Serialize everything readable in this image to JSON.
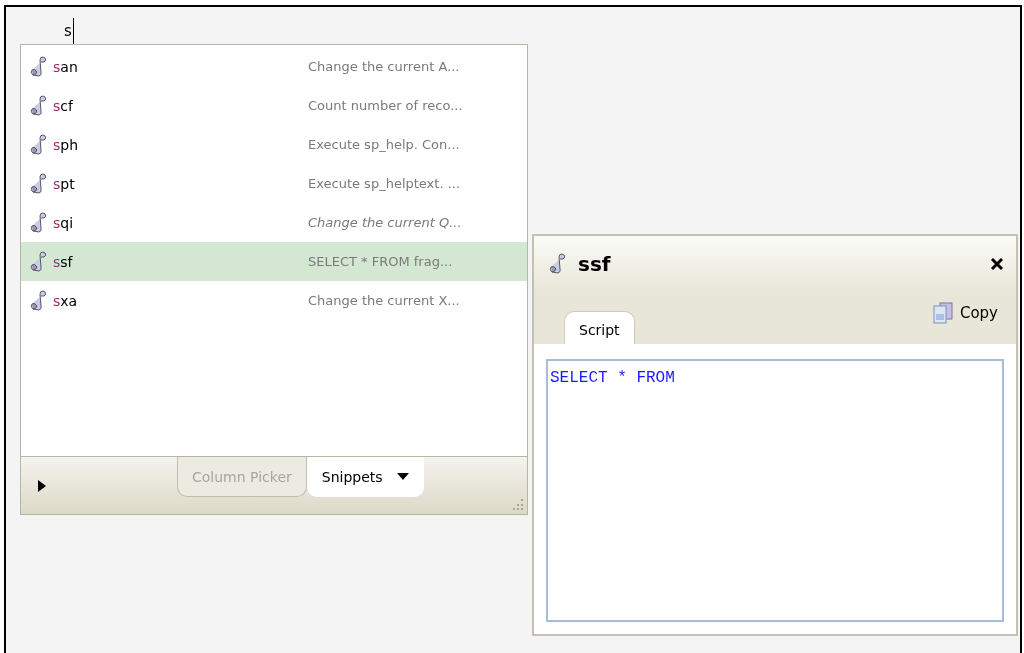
{
  "input": {
    "value": "s"
  },
  "completion_list": {
    "items": [
      {
        "match": "s",
        "rest": "an",
        "description": "Change the current A...",
        "italic": false,
        "selected": false
      },
      {
        "match": "s",
        "rest": "cf",
        "description": "Count number of reco...",
        "italic": false,
        "selected": false
      },
      {
        "match": "s",
        "rest": "ph",
        "description": "Execute sp_help. Con...",
        "italic": false,
        "selected": false
      },
      {
        "match": "s",
        "rest": "pt",
        "description": "Execute sp_helptext. ...",
        "italic": false,
        "selected": false
      },
      {
        "match": "s",
        "rest": "qi",
        "description": "Change the current Q...",
        "italic": true,
        "selected": false
      },
      {
        "match": "s",
        "rest": "sf",
        "description": "SELECT * FROM frag...",
        "italic": false,
        "selected": true
      },
      {
        "match": "s",
        "rest": "xa",
        "description": "Change the current X...",
        "italic": false,
        "selected": false
      }
    ],
    "tabs": [
      {
        "label": "Column Picker",
        "selected": false,
        "dropdown": false
      },
      {
        "label": "Snippets",
        "selected": true,
        "dropdown": true
      }
    ]
  },
  "snippet_popup": {
    "title": "ssf",
    "tabs": [
      {
        "label": "Script",
        "selected": true
      }
    ],
    "copy_label": "Copy",
    "script": "SELECT * FROM"
  }
}
